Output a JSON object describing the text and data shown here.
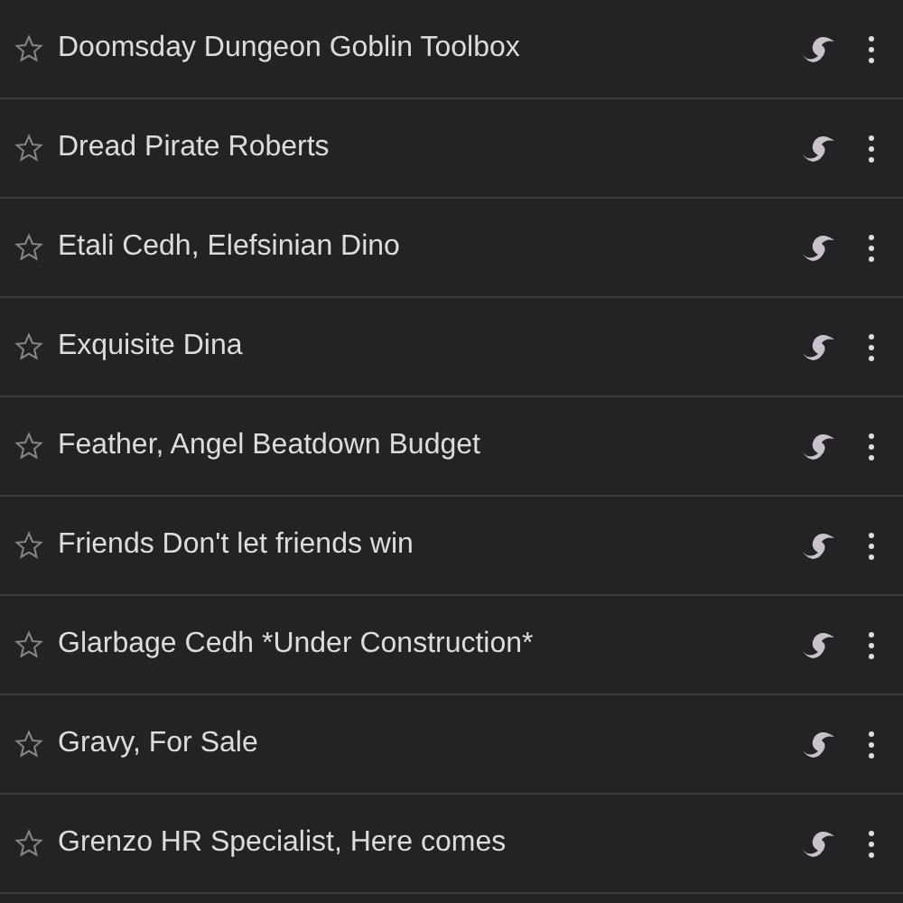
{
  "decks": [
    {
      "name": "Doomsday Dungeon Goblin Toolbox",
      "starred": false
    },
    {
      "name": "Dread Pirate Roberts",
      "starred": false
    },
    {
      "name": "Etali Cedh, Elefsinian Dino",
      "starred": false
    },
    {
      "name": "Exquisite Dina",
      "starred": false
    },
    {
      "name": "Feather, Angel Beatdown Budget",
      "starred": false
    },
    {
      "name": "Friends Don't let friends win",
      "starred": false
    },
    {
      "name": "Glarbage Cedh *Under Construction*",
      "starred": false
    },
    {
      "name": "Gravy, For Sale",
      "starred": false
    },
    {
      "name": "Grenzo HR Specialist, Here comes",
      "starred": false
    }
  ]
}
